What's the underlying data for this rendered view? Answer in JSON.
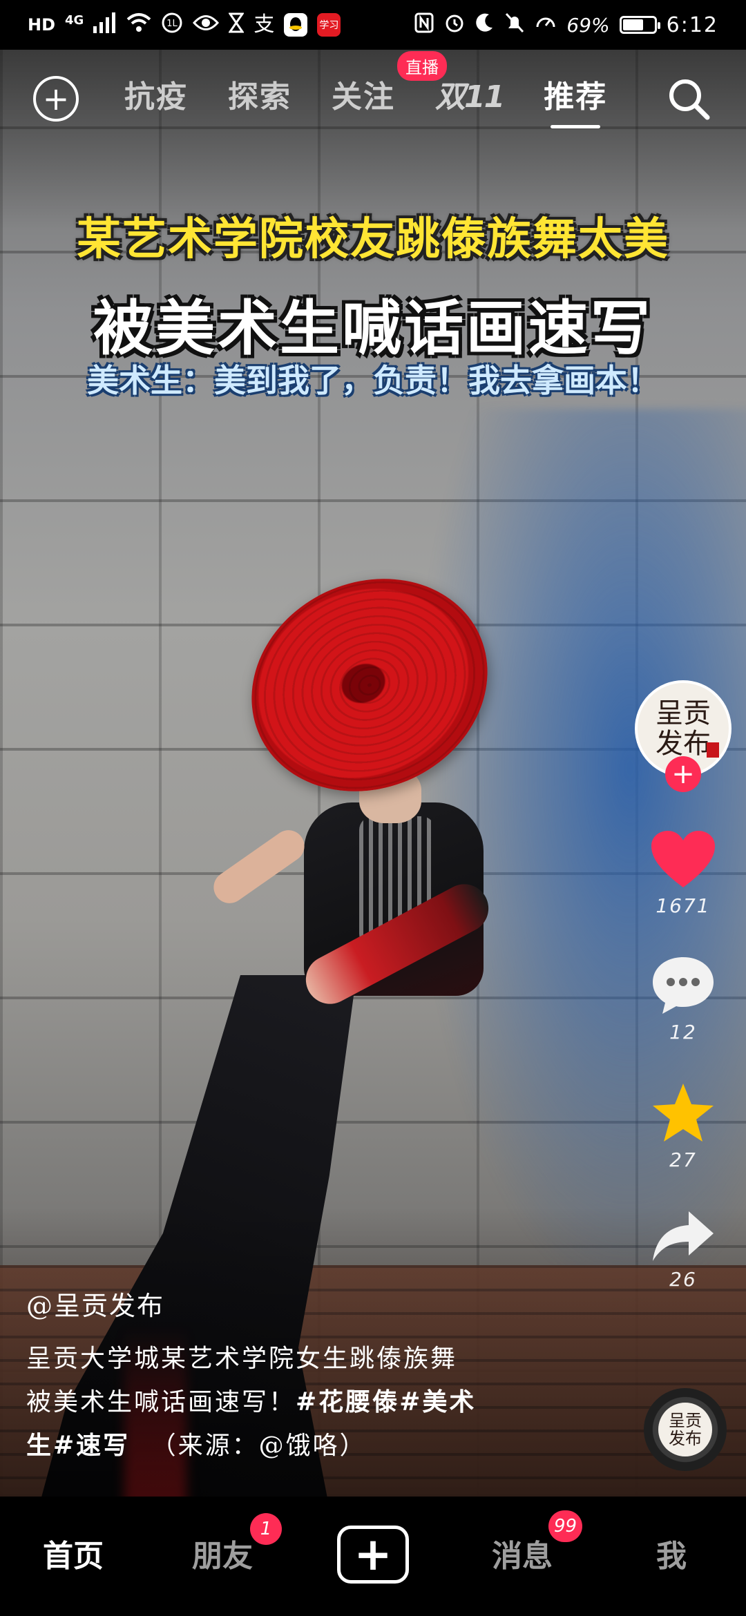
{
  "status_bar": {
    "left_chips": [
      "HD",
      "4G"
    ],
    "battery_percent": "69%",
    "battery_level": 0.69,
    "time": "6:12",
    "icons": [
      "signal-icon",
      "wifi-icon",
      "data-saver-icon",
      "eye-icon",
      "hourglass-icon",
      "alipay-icon",
      "qq-icon",
      "app-icon",
      "nfc-icon",
      "alarm-icon",
      "moon-icon",
      "bell-mute-icon",
      "speed-icon",
      "battery-icon"
    ],
    "alipay_glyph": "支",
    "app_glyph": "学习"
  },
  "top_nav": {
    "tabs": [
      {
        "label": "抗疫",
        "active": false
      },
      {
        "label": "探索",
        "active": false
      },
      {
        "label": "关注",
        "active": false,
        "badge": "直播"
      },
      {
        "label": "双11",
        "active": false
      },
      {
        "label": "推荐",
        "active": true
      }
    ]
  },
  "video": {
    "headline_1": "某艺术学院校友跳傣族舞太美",
    "headline_2": "被美术生喊话画速写",
    "headline_3": "美术生：美到我了，负责！我去拿画本！"
  },
  "rail": {
    "author_avatar_text": "呈贡\n发布",
    "likes": "1671",
    "comments": "12",
    "favorites": "27",
    "shares": "26",
    "colors": {
      "like": "#fe2c55",
      "favorite": "#ffc200",
      "follow": "#fe2c55"
    }
  },
  "caption": {
    "author": "@呈贡发布",
    "line_1": "呈贡大学城某艺术学院女生跳傣族舞",
    "line_2_prefix": "被美术生喊话画速写！",
    "tag_1": "#花腰傣",
    "tag_2": "#美术",
    "line_3_prefix": "生",
    "tag_3": "#速写",
    "source": "（来源：@饿咯）"
  },
  "bottom_tabs": {
    "home": "首页",
    "friends": "朋友",
    "friends_badge": "1",
    "create": "+",
    "messages": "消息",
    "messages_badge": "99",
    "me": "我"
  }
}
